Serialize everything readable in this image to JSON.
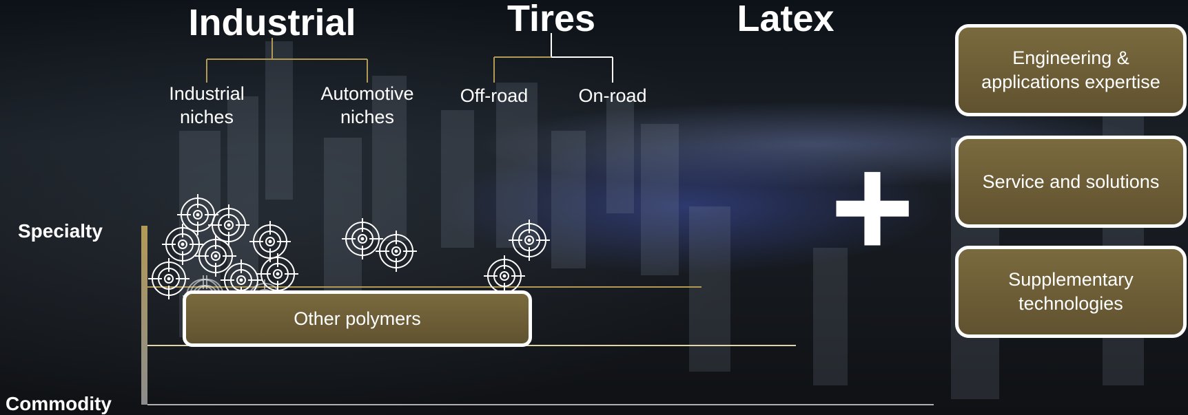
{
  "segments": {
    "industrial": {
      "title": "Industrial",
      "subs": [
        "Industrial niches",
        "Automotive niches"
      ]
    },
    "tires": {
      "title": "Tires",
      "subs": [
        "Off-road",
        "On-road"
      ]
    },
    "latex": {
      "title": "Latex"
    }
  },
  "axis": {
    "top_label": "Specialty",
    "bottom_label": "Commodity"
  },
  "other_polymers_label": "Other polymers",
  "plus_symbol": "+",
  "capabilities": [
    {
      "label": "Engineering &\napplications expertise"
    },
    {
      "label": "Service and solutions"
    },
    {
      "label": "Supplementary\ntechnologies"
    }
  ],
  "colors": {
    "gold": "#b39a55",
    "box_fill": "#6e5f38",
    "text": "#ffffff"
  },
  "icons": {
    "target": "target-icon",
    "count": 15
  }
}
